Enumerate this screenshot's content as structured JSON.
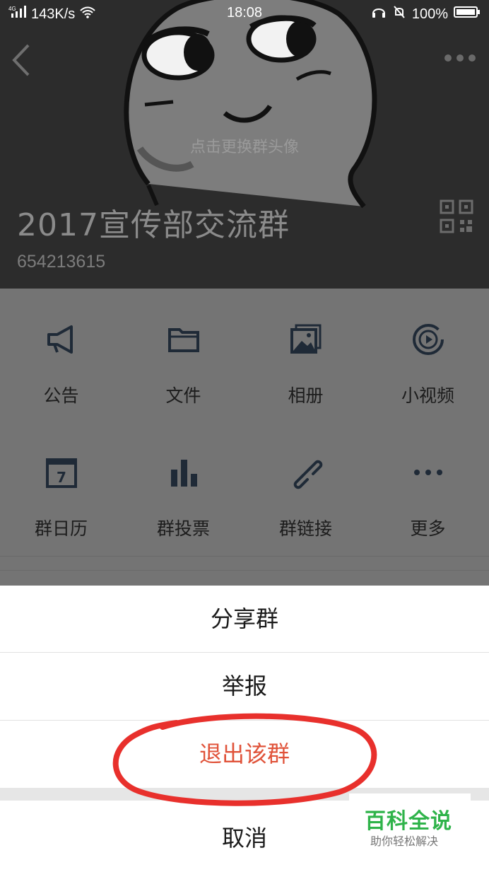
{
  "status_bar": {
    "network": "4G",
    "speed": "143K/s",
    "time": "18:08",
    "battery": "100%"
  },
  "header": {
    "hint": "点击更换群头像",
    "group_name": "2017宣传部交流群",
    "group_id": "654213615"
  },
  "functions": [
    {
      "label": "公告",
      "icon": "megaphone-icon"
    },
    {
      "label": "文件",
      "icon": "folder-icon"
    },
    {
      "label": "相册",
      "icon": "photo-album-icon"
    },
    {
      "label": "小视频",
      "icon": "video-play-icon"
    },
    {
      "label": "群日历",
      "icon": "calendar-icon"
    },
    {
      "label": "群投票",
      "icon": "bar-chart-icon"
    },
    {
      "label": "群链接",
      "icon": "link-icon"
    },
    {
      "label": "更多",
      "icon": "more-dots-icon"
    }
  ],
  "action_sheet": {
    "share": "分享群",
    "report": "举报",
    "quit": "退出该群",
    "cancel": "取消"
  },
  "watermark": {
    "title": "百科全说",
    "subtitle": "助你轻松解决"
  },
  "colors": {
    "danger": "#e0533a",
    "annotation_circle": "#e8302c",
    "watermark_green": "#2fb34a"
  }
}
